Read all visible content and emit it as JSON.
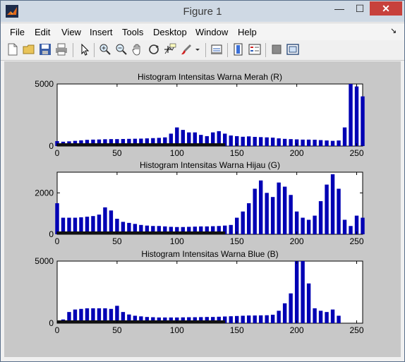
{
  "window": {
    "title": "Figure 1",
    "minimize": "—",
    "maximize": "☐",
    "close": "✕"
  },
  "menu": [
    "File",
    "Edit",
    "View",
    "Insert",
    "Tools",
    "Desktop",
    "Window",
    "Help"
  ],
  "toolbar": [
    "new-figure-icon",
    "open-file-icon",
    "save-icon",
    "print-icon",
    "select-arrow-icon",
    "zoom-in-icon",
    "zoom-out-icon",
    "pan-hand-icon",
    "rotate-3d-icon",
    "data-cursor-icon",
    "brush-icon",
    "brush-dropdown-icon",
    "link-plot-icon",
    "colorbar-icon",
    "legend-icon",
    "hide-plot-tools-icon",
    "show-plot-tools-icon"
  ],
  "chart_data": [
    {
      "type": "bar",
      "title": "Histogram Intensitas Warna Merah (R)",
      "xlim": [
        0,
        255
      ],
      "ylim": [
        0,
        5000
      ],
      "xticks": [
        "0",
        "50",
        "100",
        "150",
        "200",
        "250"
      ],
      "yticks": [
        "0",
        "5000"
      ],
      "color": "#0000b4",
      "x": [
        0,
        5,
        10,
        15,
        20,
        25,
        30,
        35,
        40,
        45,
        50,
        55,
        60,
        65,
        70,
        75,
        80,
        85,
        90,
        95,
        100,
        105,
        110,
        115,
        120,
        125,
        130,
        135,
        140,
        145,
        150,
        155,
        160,
        165,
        170,
        175,
        180,
        185,
        190,
        195,
        200,
        205,
        210,
        215,
        220,
        225,
        230,
        235,
        240,
        245,
        250,
        255
      ],
      "values": [
        400,
        350,
        380,
        420,
        460,
        500,
        520,
        530,
        550,
        560,
        560,
        570,
        580,
        590,
        600,
        620,
        640,
        660,
        700,
        1000,
        1500,
        1300,
        1100,
        1100,
        900,
        800,
        1100,
        1200,
        1000,
        850,
        800,
        750,
        780,
        740,
        720,
        700,
        680,
        620,
        580,
        560,
        540,
        520,
        520,
        510,
        480,
        450,
        420,
        450,
        1500,
        5000,
        4800,
        4000
      ]
    },
    {
      "type": "bar",
      "title": "Histogram Intensitas Warna Hijau (G)",
      "xlim": [
        0,
        255
      ],
      "ylim": [
        0,
        3000
      ],
      "xticks": [
        "0",
        "50",
        "100",
        "150",
        "200",
        "250"
      ],
      "yticks": [
        "0",
        "2000"
      ],
      "color": "#0000b4",
      "x": [
        0,
        5,
        10,
        15,
        20,
        25,
        30,
        35,
        40,
        45,
        50,
        55,
        60,
        65,
        70,
        75,
        80,
        85,
        90,
        95,
        100,
        105,
        110,
        115,
        120,
        125,
        130,
        135,
        140,
        145,
        150,
        155,
        160,
        165,
        170,
        175,
        180,
        185,
        190,
        195,
        200,
        205,
        210,
        215,
        220,
        225,
        230,
        235,
        240,
        245,
        250,
        255
      ],
      "values": [
        1500,
        800,
        800,
        800,
        820,
        850,
        880,
        950,
        1300,
        1150,
        750,
        600,
        550,
        500,
        450,
        420,
        400,
        400,
        380,
        360,
        350,
        350,
        360,
        370,
        380,
        380,
        390,
        400,
        420,
        450,
        800,
        1100,
        1500,
        2200,
        2600,
        2000,
        1800,
        2500,
        2300,
        1900,
        1100,
        800,
        700,
        900,
        1600,
        2400,
        2900,
        2200,
        700,
        400,
        900,
        800
      ]
    },
    {
      "type": "bar",
      "title": "Histogram Intensitas Warna Blue (B)",
      "xlim": [
        0,
        255
      ],
      "ylim": [
        0,
        5000
      ],
      "xticks": [
        "0",
        "50",
        "100",
        "150",
        "200",
        "250"
      ],
      "yticks": [
        "0",
        "5000"
      ],
      "color": "#0000b4",
      "x": [
        0,
        5,
        10,
        15,
        20,
        25,
        30,
        35,
        40,
        45,
        50,
        55,
        60,
        65,
        70,
        75,
        80,
        85,
        90,
        95,
        100,
        105,
        110,
        115,
        120,
        125,
        130,
        135,
        140,
        145,
        150,
        155,
        160,
        165,
        170,
        175,
        180,
        185,
        190,
        195,
        200,
        205,
        210,
        215,
        220,
        225,
        230,
        235,
        240,
        245,
        250,
        255
      ],
      "values": [
        0,
        300,
        900,
        1100,
        1150,
        1200,
        1200,
        1200,
        1200,
        1150,
        1400,
        900,
        700,
        600,
        550,
        500,
        480,
        460,
        460,
        460,
        460,
        470,
        480,
        480,
        490,
        500,
        500,
        520,
        540,
        560,
        580,
        600,
        620,
        620,
        630,
        640,
        680,
        1000,
        1600,
        2400,
        5000,
        5000,
        3200,
        1200,
        1000,
        900,
        1100,
        600,
        0,
        0,
        0,
        0
      ]
    }
  ]
}
